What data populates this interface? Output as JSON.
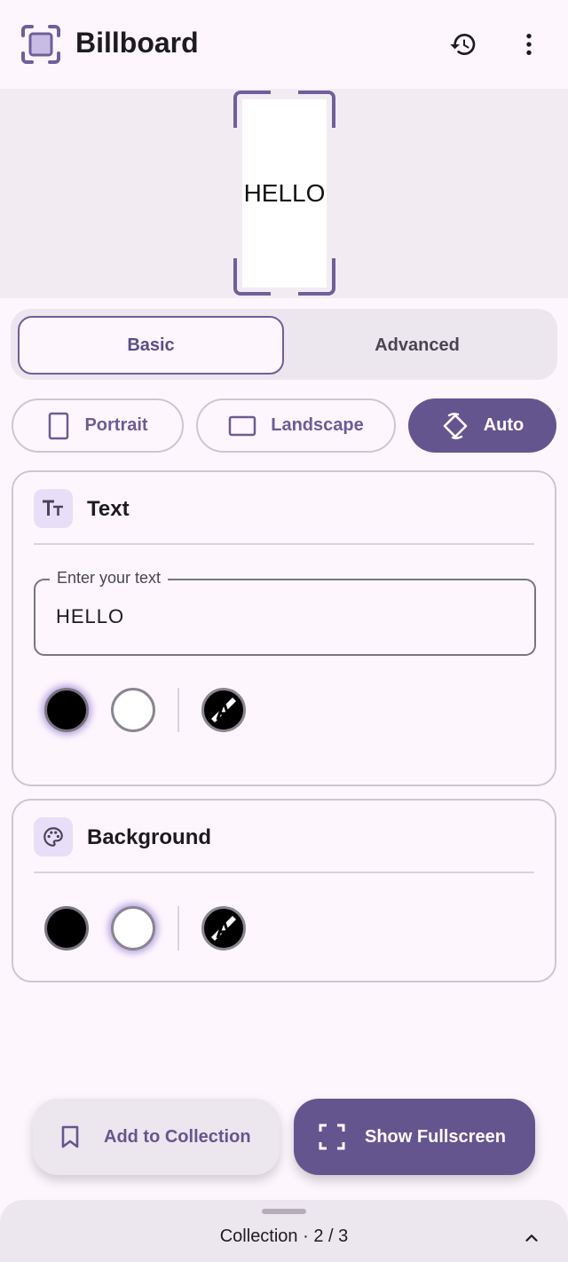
{
  "app": {
    "title": "Billboard"
  },
  "preview": {
    "text": "HELLO"
  },
  "mode_tabs": {
    "basic": "Basic",
    "advanced": "Advanced",
    "selected": "Basic"
  },
  "orientation": {
    "portrait": "Portrait",
    "landscape": "Landscape",
    "auto": "Auto",
    "selected": "Auto"
  },
  "text_card": {
    "title": "Text",
    "field_label": "Enter your text",
    "field_value": "HELLO",
    "selected_color": "black"
  },
  "background_card": {
    "title": "Background",
    "selected_color": "white"
  },
  "actions": {
    "add_to_collection": "Add to Collection",
    "show_fullscreen": "Show Fullscreen"
  },
  "sheet": {
    "label": "Collection · 2 / 3"
  },
  "colors": {
    "accent": "#65558f",
    "surface": "#fdf7fd",
    "surface_variant": "#ece6ee",
    "icon_container": "#e8def8"
  },
  "icons": [
    "app-logo-icon",
    "history-icon",
    "more-vert-icon",
    "portrait-icon",
    "landscape-icon",
    "screen-rotation-icon",
    "text-fields-icon",
    "palette-icon",
    "auto-color-icon",
    "bookmark-icon",
    "fullscreen-icon",
    "chevron-up-icon"
  ]
}
